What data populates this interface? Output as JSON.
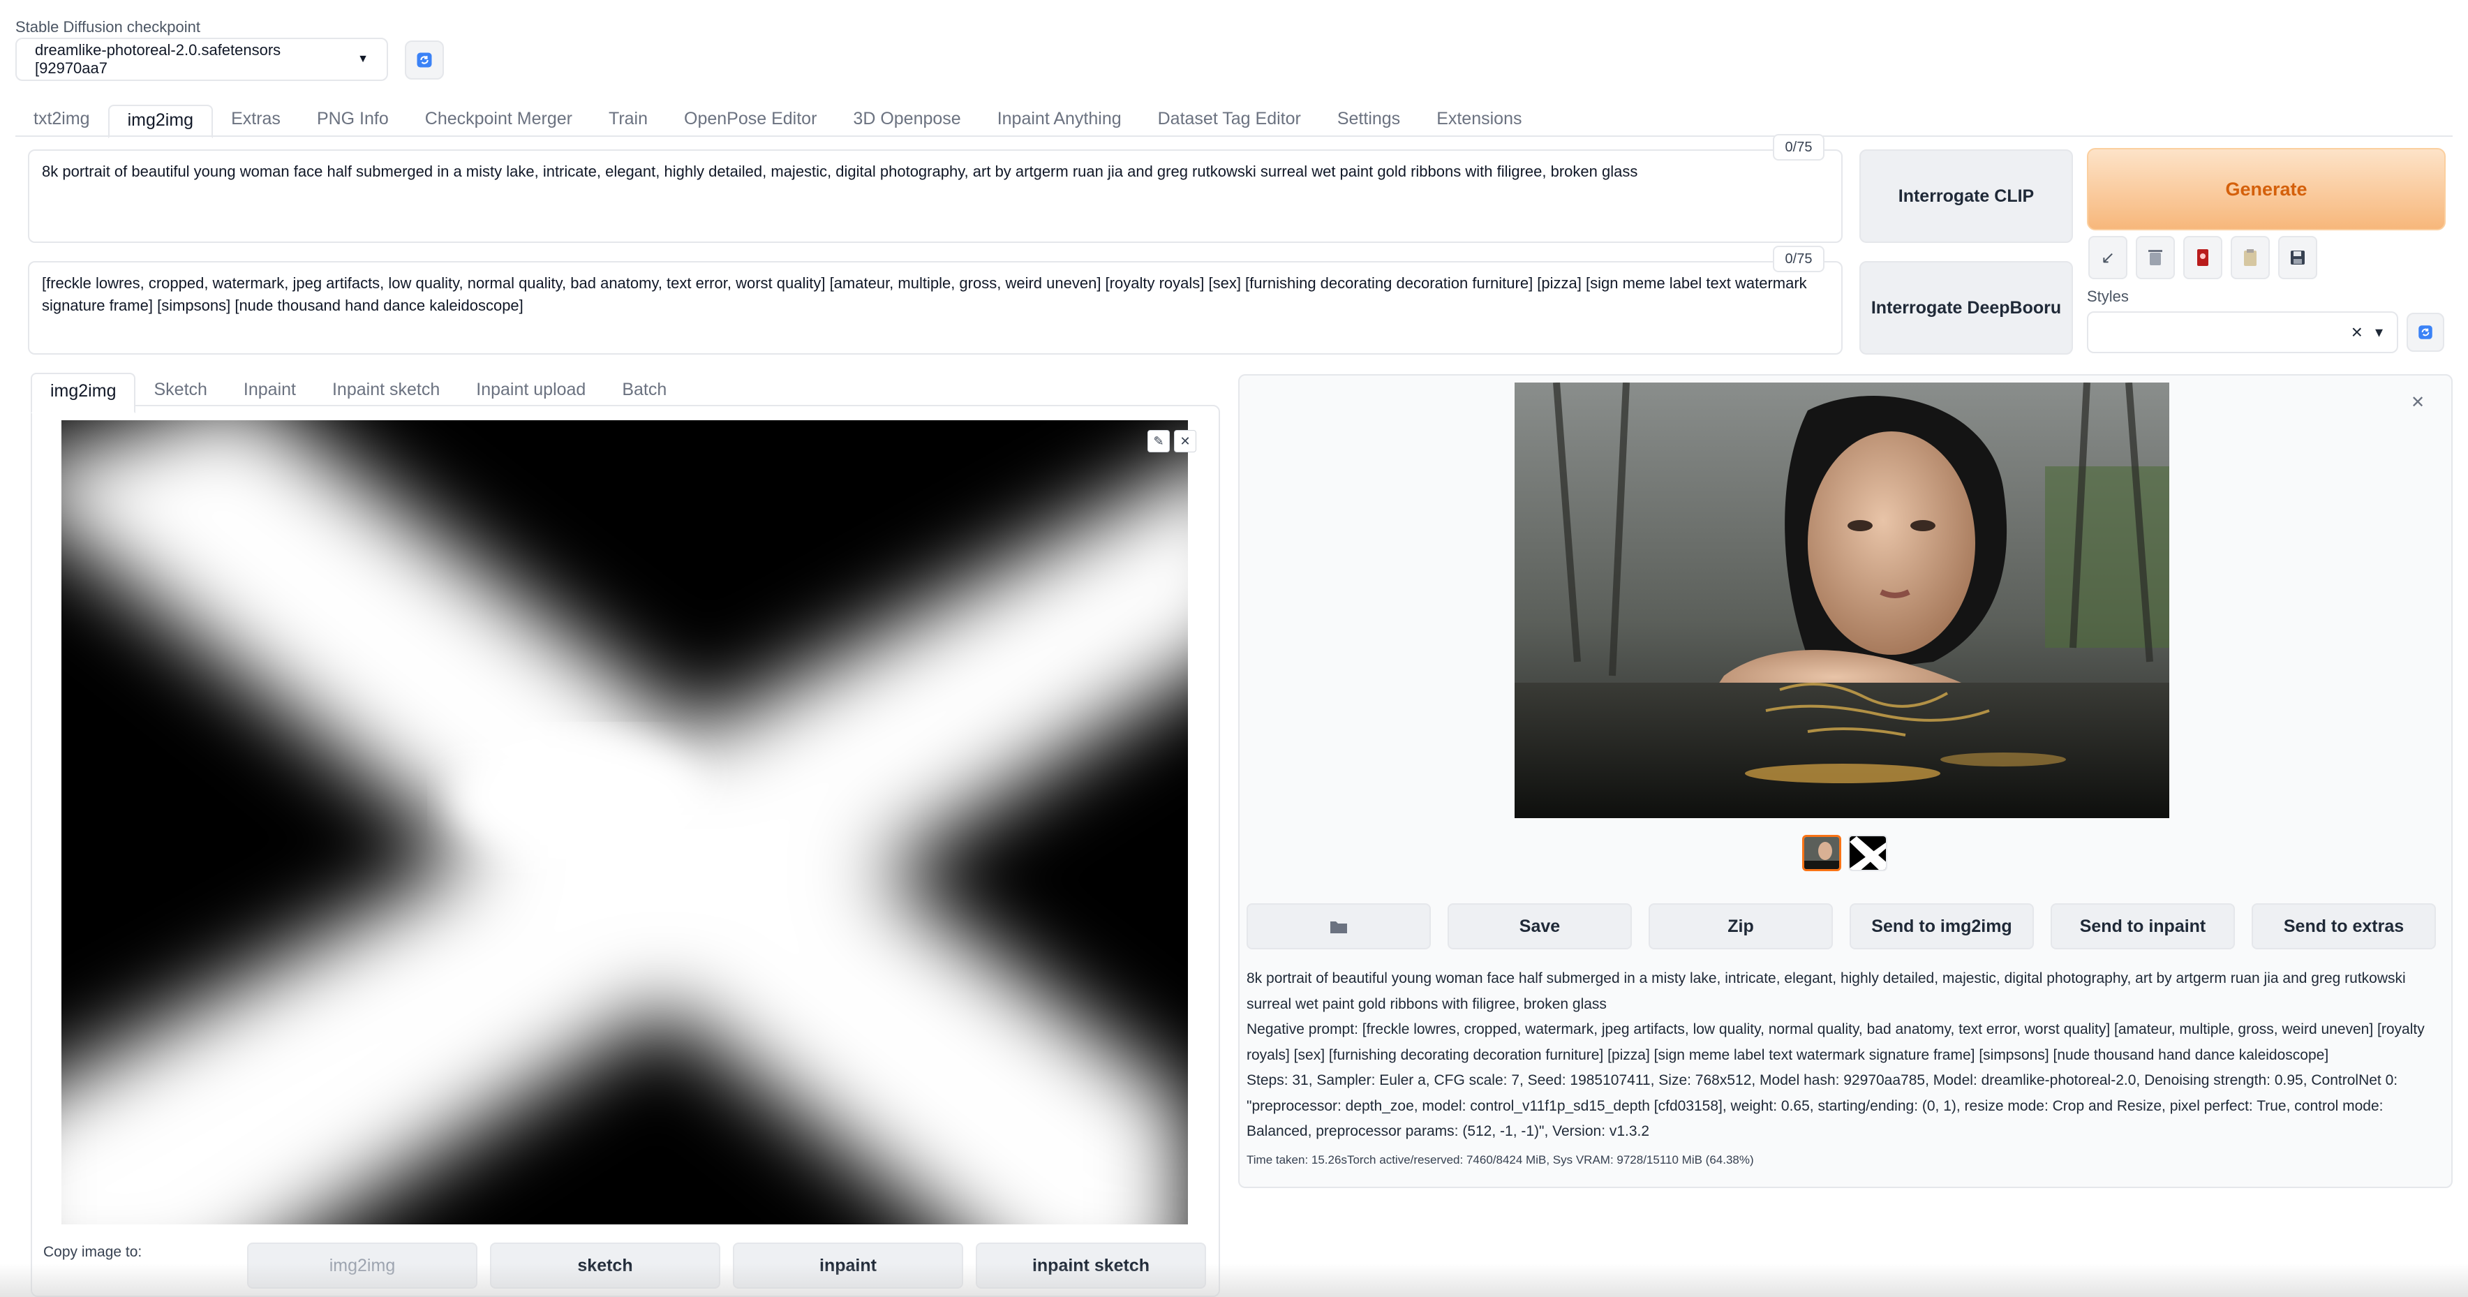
{
  "checkpoint": {
    "label": "Stable Diffusion checkpoint",
    "value": "dreamlike-photoreal-2.0.safetensors [92970aa7"
  },
  "tabs": [
    "txt2img",
    "img2img",
    "Extras",
    "PNG Info",
    "Checkpoint Merger",
    "Train",
    "OpenPose Editor",
    "3D Openpose",
    "Inpaint Anything",
    "Dataset Tag Editor",
    "Settings",
    "Extensions"
  ],
  "active_tab": "img2img",
  "prompt": {
    "text": "8k portrait of beautiful young woman face half submerged in a misty lake, intricate, elegant, highly detailed, majestic, digital photography, art by artgerm ruan jia and greg rutkowski surreal wet paint gold ribbons with filigree, broken glass",
    "counter": "0/75"
  },
  "negative_prompt": {
    "text": "[freckle lowres, cropped, watermark, jpeg artifacts, low quality, normal quality, bad anatomy, text error, worst quality] [amateur, multiple, gross, weird uneven] [royalty royals] [sex] [furnishing decorating decoration furniture] [pizza] [sign meme label text watermark signature frame] [simpsons] [nude thousand hand dance kaleidoscope]",
    "counter": "0/75"
  },
  "buttons": {
    "interrogate_clip": "Interrogate CLIP",
    "interrogate_deepbooru": "Interrogate DeepBooru",
    "generate": "Generate"
  },
  "styles": {
    "label": "Styles",
    "clear": "×",
    "caret": "▾"
  },
  "subtabs": [
    "img2img",
    "Sketch",
    "Inpaint",
    "Inpaint sketch",
    "Inpaint upload",
    "Batch"
  ],
  "copy_to": {
    "label": "Copy image to:",
    "buttons": [
      "img2img",
      "sketch",
      "inpaint",
      "inpaint sketch"
    ]
  },
  "actions": [
    "Save",
    "Zip",
    "Send to img2img",
    "Send to inpaint",
    "Send to extras"
  ],
  "info": {
    "prompt": "8k portrait of beautiful young woman face half submerged in a misty lake, intricate, elegant, highly detailed, majestic, digital photography, art by artgerm ruan jia and greg rutkowski surreal wet paint gold ribbons with filigree, broken glass",
    "negative": "Negative prompt: [freckle lowres, cropped, watermark, jpeg artifacts, low quality, normal quality, bad anatomy, text error, worst quality] [amateur, multiple, gross, weird uneven] [royalty royals] [sex] [furnishing decorating decoration furniture] [pizza] [sign meme label text watermark signature frame] [simpsons] [nude thousand hand dance kaleidoscope]",
    "params": "Steps: 31, Sampler: Euler a, CFG scale: 7, Seed: 1985107411, Size: 768x512, Model hash: 92970aa785, Model: dreamlike-photoreal-2.0, Denoising strength: 0.95, ControlNet 0: \"preprocessor: depth_zoe, model: control_v11f1p_sd15_depth [cfd03158], weight: 0.65, starting/ending: (0, 1), resize mode: Crop and Resize, pixel perfect: True, control mode: Balanced, preprocessor params: (512, -1, -1)\", Version: v1.3.2",
    "time": "Time taken: 15.26sTorch active/reserved: 7460/8424 MiB, Sys VRAM: 9728/15110 MiB (64.38%)"
  },
  "colors": {
    "accent": "#f97316",
    "generate_bg": "#fbc592",
    "border": "#e5e7eb"
  }
}
